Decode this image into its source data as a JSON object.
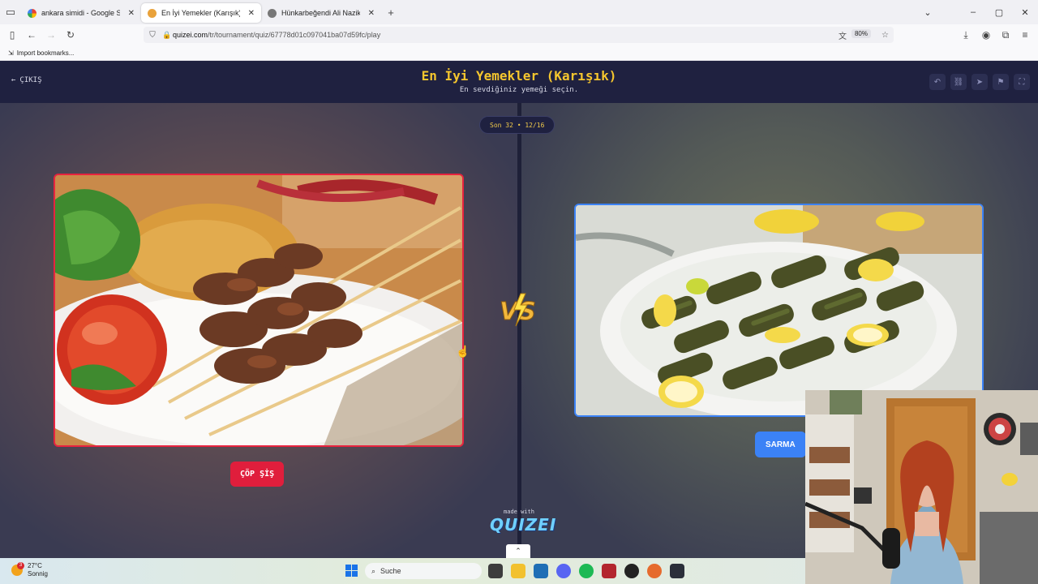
{
  "browser": {
    "tabs": [
      {
        "title": "ankara simidi - Google Search",
        "active": false
      },
      {
        "title": "En İyi Yemekler (Karışık) - Quizei",
        "active": true
      },
      {
        "title": "Hünkarbeğendi Ali Nazik farkı",
        "active": false
      }
    ],
    "url_domain": "quizei.com",
    "url_path": "/tr/tournament/quiz/67778d01c097041ba07d59fc/play",
    "zoom": "80%",
    "bookmark": "Import bookmarks..."
  },
  "page": {
    "exit_label": "ÇIKIŞ",
    "title": "En İyi Yemekler (Karışık)",
    "subtitle": "En sevdiğiniz yemeği seçin.",
    "round_badge": "Son 32 • 12/16",
    "vs_label": "VS",
    "left_choice": {
      "label": "ÇÖP ŞİŞ"
    },
    "right_choice": {
      "label": "SARMA"
    },
    "made_with": "made with",
    "logo": "QUIZEI",
    "colors": {
      "title": "#f5c62e",
      "left_accent": "#e8233f",
      "right_accent": "#3b82f6",
      "header_bg": "#1f2140"
    }
  },
  "taskbar": {
    "temperature": "27°C",
    "weather": "Sonnig",
    "weather_alert": "3",
    "search_placeholder": "Suche"
  }
}
